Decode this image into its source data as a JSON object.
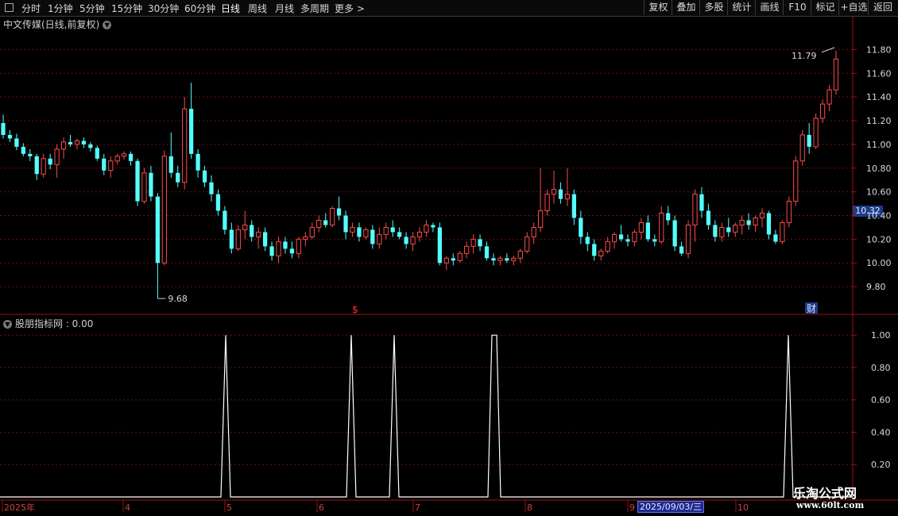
{
  "toolbar": {
    "periods": [
      "分时",
      "1分钟",
      "5分钟",
      "15分钟",
      "30分钟",
      "60分钟",
      "日线",
      "周线",
      "月线",
      "多周期",
      "更多 >"
    ],
    "active_period": "日线",
    "right_buttons": [
      "复权",
      "叠加",
      "多股",
      "统计",
      "画线",
      "F10",
      "标记",
      "+自选",
      "返回"
    ]
  },
  "main": {
    "title": "中文传媒(日线,前复权)",
    "high_marker": "11.79",
    "low_marker": "9.68",
    "current_price": "10.32",
    "event_marker_1": "$",
    "event_marker_2": "财"
  },
  "indicator": {
    "title": "股朋指标网 : 0.00"
  },
  "x_axis": {
    "labels": [
      "2025年",
      "4",
      "5",
      "6",
      "7",
      "8",
      "9",
      "10"
    ],
    "cursor_date": "2025/09/03/三"
  },
  "watermark": {
    "line1": "乐淘公式网",
    "line2": "www.60lt.com"
  },
  "colors": {
    "up": "#ff4a4a",
    "down": "#54ffff",
    "grid": "#6a1010",
    "axis": "#a01010",
    "indicator_line": "#ffffff",
    "background": "#000000"
  },
  "chart_data": [
    {
      "type": "candlestick",
      "title": "中文传媒(日线,前复权)",
      "y_ticks": [
        "11.80",
        "11.60",
        "11.40",
        "11.20",
        "11.00",
        "10.80",
        "10.60",
        "10.40",
        "10.20",
        "10.00",
        "9.80"
      ],
      "ylim": [
        9.62,
        11.95
      ],
      "x_labels": [
        "2025年",
        "4",
        "5",
        "6",
        "7",
        "8",
        "9",
        "10"
      ],
      "candles": [
        [
          11.18,
          11.25,
          11.05,
          11.08
        ],
        [
          11.08,
          11.12,
          11.02,
          11.05
        ],
        [
          11.05,
          11.09,
          10.95,
          10.98
        ],
        [
          10.98,
          11.01,
          10.9,
          10.92
        ],
        [
          10.92,
          10.96,
          10.86,
          10.9
        ],
        [
          10.9,
          10.92,
          10.7,
          10.75
        ],
        [
          10.75,
          10.92,
          10.72,
          10.88
        ],
        [
          10.88,
          10.92,
          10.79,
          10.83
        ],
        [
          10.83,
          11.0,
          10.72,
          10.96
        ],
        [
          10.96,
          11.06,
          10.88,
          11.02
        ],
        [
          11.02,
          11.08,
          10.98,
          11.0
        ],
        [
          11.0,
          11.05,
          10.96,
          11.03
        ],
        [
          11.03,
          11.06,
          10.97,
          11.0
        ],
        [
          11.0,
          11.02,
          10.94,
          10.97
        ],
        [
          10.97,
          10.99,
          10.86,
          10.88
        ],
        [
          10.88,
          10.92,
          10.74,
          10.78
        ],
        [
          10.78,
          10.9,
          10.72,
          10.86
        ],
        [
          10.86,
          10.92,
          10.83,
          10.9
        ],
        [
          10.9,
          10.94,
          10.87,
          10.92
        ],
        [
          10.92,
          10.94,
          10.82,
          10.86
        ],
        [
          10.86,
          10.88,
          10.48,
          10.52
        ],
        [
          10.52,
          10.8,
          10.5,
          10.76
        ],
        [
          10.76,
          10.82,
          10.52,
          10.56
        ],
        [
          10.56,
          10.59,
          9.7,
          10.0
        ],
        [
          10.0,
          10.95,
          9.98,
          10.9
        ],
        [
          10.9,
          11.1,
          10.72,
          10.76
        ],
        [
          10.76,
          10.82,
          10.64,
          10.68
        ],
        [
          10.68,
          11.4,
          10.62,
          11.3
        ],
        [
          11.3,
          11.52,
          10.88,
          10.92
        ],
        [
          10.92,
          10.96,
          10.72,
          10.78
        ],
        [
          10.78,
          10.82,
          10.64,
          10.68
        ],
        [
          10.68,
          10.74,
          10.52,
          10.58
        ],
        [
          10.58,
          10.62,
          10.4,
          10.44
        ],
        [
          10.44,
          10.48,
          10.24,
          10.28
        ],
        [
          10.28,
          10.34,
          10.08,
          10.12
        ],
        [
          10.12,
          10.32,
          10.1,
          10.28
        ],
        [
          10.28,
          10.44,
          10.2,
          10.32
        ],
        [
          10.32,
          10.36,
          10.18,
          10.22
        ],
        [
          10.22,
          10.3,
          10.12,
          10.26
        ],
        [
          10.26,
          10.3,
          10.1,
          10.14
        ],
        [
          10.14,
          10.18,
          10.02,
          10.06
        ],
        [
          10.06,
          10.22,
          10.0,
          10.18
        ],
        [
          10.18,
          10.22,
          10.08,
          10.12
        ],
        [
          10.12,
          10.18,
          10.04,
          10.08
        ],
        [
          10.08,
          10.22,
          10.04,
          10.2
        ],
        [
          10.2,
          10.26,
          10.14,
          10.22
        ],
        [
          10.22,
          10.34,
          10.2,
          10.3
        ],
        [
          10.3,
          10.4,
          10.26,
          10.36
        ],
        [
          10.36,
          10.42,
          10.3,
          10.32
        ],
        [
          10.32,
          10.48,
          10.3,
          10.46
        ],
        [
          10.46,
          10.56,
          10.36,
          10.4
        ],
        [
          10.4,
          10.44,
          10.2,
          10.26
        ],
        [
          10.26,
          10.34,
          10.22,
          10.3
        ],
        [
          10.3,
          10.34,
          10.18,
          10.22
        ],
        [
          10.22,
          10.3,
          10.2,
          10.28
        ],
        [
          10.28,
          10.32,
          10.12,
          10.16
        ],
        [
          10.16,
          10.3,
          10.12,
          10.24
        ],
        [
          10.24,
          10.34,
          10.2,
          10.3
        ],
        [
          10.3,
          10.36,
          10.22,
          10.26
        ],
        [
          10.26,
          10.3,
          10.2,
          10.22
        ],
        [
          10.22,
          10.26,
          10.12,
          10.16
        ],
        [
          10.16,
          10.26,
          10.1,
          10.22
        ],
        [
          10.22,
          10.3,
          10.18,
          10.26
        ],
        [
          10.26,
          10.36,
          10.22,
          10.32
        ],
        [
          10.32,
          10.34,
          10.26,
          10.3
        ],
        [
          10.3,
          10.34,
          9.98,
          10.0
        ],
        [
          10.0,
          10.06,
          9.94,
          10.04
        ],
        [
          10.04,
          10.08,
          9.98,
          10.02
        ],
        [
          10.02,
          10.1,
          10.0,
          10.08
        ],
        [
          10.08,
          10.18,
          10.04,
          10.14
        ],
        [
          10.14,
          10.24,
          10.08,
          10.2
        ],
        [
          10.2,
          10.24,
          10.1,
          10.14
        ],
        [
          10.14,
          10.18,
          10.02,
          10.04
        ],
        [
          10.04,
          10.08,
          9.98,
          10.02
        ],
        [
          10.02,
          10.06,
          9.98,
          10.04
        ],
        [
          10.04,
          10.08,
          10.0,
          10.02
        ],
        [
          10.02,
          10.06,
          9.98,
          10.04
        ],
        [
          10.04,
          10.12,
          10.0,
          10.1
        ],
        [
          10.1,
          10.26,
          10.08,
          10.22
        ],
        [
          10.22,
          10.34,
          10.16,
          10.3
        ],
        [
          10.3,
          10.8,
          10.26,
          10.44
        ],
        [
          10.44,
          10.62,
          10.4,
          10.58
        ],
        [
          10.58,
          10.78,
          10.5,
          10.62
        ],
        [
          10.62,
          10.68,
          10.5,
          10.54
        ],
        [
          10.54,
          10.8,
          10.48,
          10.58
        ],
        [
          10.58,
          10.62,
          10.32,
          10.38
        ],
        [
          10.38,
          10.44,
          10.16,
          10.22
        ],
        [
          10.22,
          10.26,
          10.1,
          10.16
        ],
        [
          10.16,
          10.2,
          10.02,
          10.06
        ],
        [
          10.06,
          10.12,
          10.02,
          10.1
        ],
        [
          10.1,
          10.22,
          10.08,
          10.18
        ],
        [
          10.18,
          10.26,
          10.12,
          10.24
        ],
        [
          10.24,
          10.32,
          10.18,
          10.2
        ],
        [
          10.2,
          10.24,
          10.14,
          10.18
        ],
        [
          10.18,
          10.28,
          10.14,
          10.26
        ],
        [
          10.26,
          10.38,
          10.2,
          10.34
        ],
        [
          10.34,
          10.4,
          10.18,
          10.2
        ],
        [
          10.2,
          10.24,
          10.14,
          10.18
        ],
        [
          10.18,
          10.48,
          10.16,
          10.42
        ],
        [
          10.42,
          10.48,
          10.32,
          10.36
        ],
        [
          10.36,
          10.4,
          10.1,
          10.14
        ],
        [
          10.14,
          10.18,
          10.06,
          10.08
        ],
        [
          10.08,
          10.36,
          10.04,
          10.32
        ],
        [
          10.32,
          10.62,
          10.18,
          10.58
        ],
        [
          10.58,
          10.64,
          10.38,
          10.44
        ],
        [
          10.44,
          10.5,
          10.28,
          10.32
        ],
        [
          10.32,
          10.36,
          10.18,
          10.22
        ],
        [
          10.22,
          10.34,
          10.18,
          10.3
        ],
        [
          10.3,
          10.38,
          10.22,
          10.26
        ],
        [
          10.26,
          10.34,
          10.22,
          10.32
        ],
        [
          10.32,
          10.4,
          10.24,
          10.36
        ],
        [
          10.36,
          10.42,
          10.28,
          10.32
        ],
        [
          10.32,
          10.4,
          10.26,
          10.38
        ],
        [
          10.38,
          10.46,
          10.3,
          10.42
        ],
        [
          10.42,
          10.44,
          10.2,
          10.24
        ],
        [
          10.24,
          10.28,
          10.16,
          10.18
        ],
        [
          10.18,
          10.36,
          10.16,
          10.34
        ],
        [
          10.34,
          10.56,
          10.3,
          10.52
        ],
        [
          10.52,
          10.9,
          10.48,
          10.86
        ],
        [
          10.86,
          11.12,
          10.82,
          11.08
        ],
        [
          11.08,
          11.18,
          10.92,
          10.98
        ],
        [
          10.98,
          11.26,
          10.96,
          11.22
        ],
        [
          11.22,
          11.38,
          11.18,
          11.34
        ],
        [
          11.34,
          11.5,
          11.28,
          11.46
        ],
        [
          11.46,
          11.79,
          11.42,
          11.72
        ]
      ]
    },
    {
      "type": "line",
      "title": "股朋指标网 : 0.00",
      "y_ticks": [
        "1.00",
        "0.80",
        "0.60",
        "0.40",
        "0.20"
      ],
      "ylim": [
        0,
        1.05
      ],
      "values": [
        0,
        0,
        0,
        0,
        0,
        0,
        0,
        0,
        0,
        0,
        0,
        0,
        0,
        0,
        0,
        0,
        0,
        0,
        0,
        0,
        0,
        0,
        0,
        0,
        0,
        0,
        0,
        0,
        0,
        0,
        0,
        0,
        0,
        0,
        0,
        0,
        0,
        0,
        0,
        0,
        0,
        0,
        0,
        0,
        0,
        0,
        0,
        0,
        0,
        0,
        0,
        0,
        0,
        0,
        0,
        0,
        0,
        0,
        0,
        0,
        0,
        0,
        0,
        0,
        0,
        0,
        0,
        0,
        0,
        0,
        0,
        0,
        0,
        0,
        0,
        0,
        0,
        0,
        0,
        0,
        0,
        0,
        0,
        0,
        0,
        0,
        0,
        0,
        0,
        0,
        0,
        0,
        0,
        0,
        0,
        0,
        0,
        0,
        0,
        0,
        0,
        0,
        0,
        0,
        0,
        0,
        0,
        0,
        0,
        0,
        0,
        0,
        0,
        0,
        0,
        0,
        0,
        0,
        0,
        0,
        0,
        0,
        0,
        0,
        0,
        0,
        0,
        0,
        0,
        0,
        0,
        0,
        0,
        0,
        0,
        0,
        0,
        0,
        0,
        0,
        0,
        0,
        0,
        0,
        0,
        0,
        0,
        0,
        0,
        0,
        0,
        0,
        0,
        0,
        0,
        0,
        0,
        0,
        0,
        0,
        0,
        0,
        0,
        0,
        0,
        0,
        0,
        0,
        0,
        0,
        0,
        0,
        0,
        0,
        0,
        0,
        0,
        0,
        0,
        0,
        0,
        0,
        0,
        0,
        0,
        0,
        0,
        0,
        0,
        0,
        0,
        0,
        0,
        0,
        0,
        0,
        0,
        0,
        0,
        0,
        0,
        0,
        0,
        0,
        0,
        0,
        0,
        0,
        0,
        0,
        0,
        0,
        0,
        0,
        0,
        0,
        0,
        0,
        0,
        0,
        0,
        0,
        0,
        0,
        0,
        0,
        0,
        0,
        0,
        0,
        0,
        0,
        0,
        0,
        0,
        0,
        0,
        0,
        0,
        0,
        0,
        0,
        0,
        0,
        0,
        0,
        0,
        0,
        0,
        0,
        0,
        0,
        0,
        0
      ],
      "spikes_at_label_positions": [
        1.0,
        1.0,
        1.0,
        1.0,
        1.0
      ]
    }
  ]
}
